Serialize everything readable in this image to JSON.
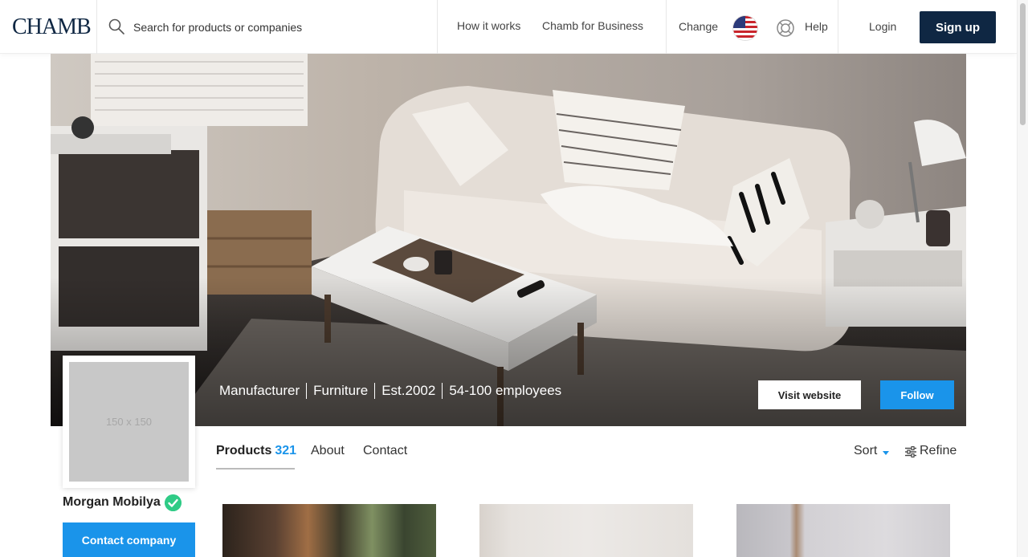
{
  "header": {
    "logo": "CHAMB",
    "search_placeholder": "Search for products or companies",
    "nav": {
      "how_it_works": "How it works",
      "for_business": "Chamb for Business",
      "change": "Change",
      "help": "Help",
      "login": "Login",
      "signup": "Sign up"
    }
  },
  "hero": {
    "meta": [
      "Manufacturer",
      "Furniture",
      "Est.2002",
      "54-100 employees"
    ],
    "visit_website": "Visit website",
    "follow": "Follow"
  },
  "company": {
    "avatar_placeholder": "150 x 150",
    "name": "Morgan Mobilya",
    "contact_button": "Contact company"
  },
  "tabs": {
    "products_label": "Products",
    "products_count": "321",
    "about": "About",
    "contact": "Contact",
    "sort": "Sort",
    "refine": "Refine"
  },
  "colors": {
    "brand_navy": "#0f2743",
    "accent_blue": "#1a94ea",
    "verified_green": "#2fcb86"
  }
}
